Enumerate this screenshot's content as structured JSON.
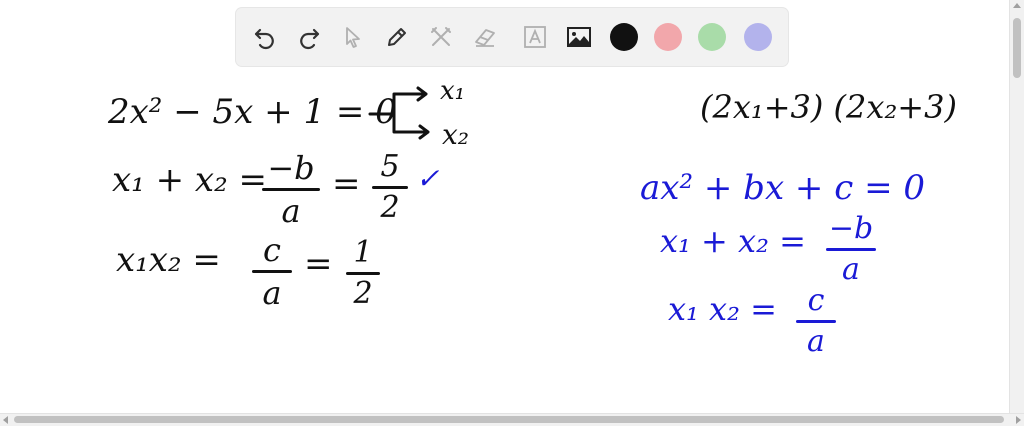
{
  "toolbar": {
    "tools": [
      {
        "name": "undo-icon",
        "enabled": true
      },
      {
        "name": "redo-icon",
        "enabled": true
      },
      {
        "name": "select-pointer-icon",
        "enabled": false
      },
      {
        "name": "pen-icon",
        "enabled": true
      },
      {
        "name": "tools-icon",
        "enabled": false
      },
      {
        "name": "eraser-icon",
        "enabled": false
      },
      {
        "name": "text-icon",
        "enabled": false
      },
      {
        "name": "image-icon",
        "enabled": true
      }
    ],
    "colors": [
      "#111111",
      "#f2a7ab",
      "#a9dca9",
      "#b3b3ec"
    ],
    "active_color": "#111111"
  },
  "board": {
    "left": {
      "equation": "2x² − 5x + 1 = 0",
      "roots_top": "x₁",
      "roots_bottom": "x₂",
      "sum_lhs": "x₁ + x₂ =",
      "sum_num": "−b",
      "sum_den": "a",
      "sum_eq": "=",
      "sum_val_num": "5",
      "sum_val_den": "2",
      "check": "✓",
      "prod_lhs": "x₁x₂ =",
      "prod_num": "c",
      "prod_den": "a",
      "prod_eq": "=",
      "prod_val_num": "1",
      "prod_val_den": "2"
    },
    "right": {
      "expression": "(2x₁+3) (2x₂+3)",
      "general": "ax² + bx + c = 0",
      "sum_lhs": "x₁ + x₂ =",
      "sum_num": "−b",
      "sum_den": "a",
      "prod_lhs": "x₁ x₂ =",
      "prod_num": "c",
      "prod_den": "a"
    }
  }
}
